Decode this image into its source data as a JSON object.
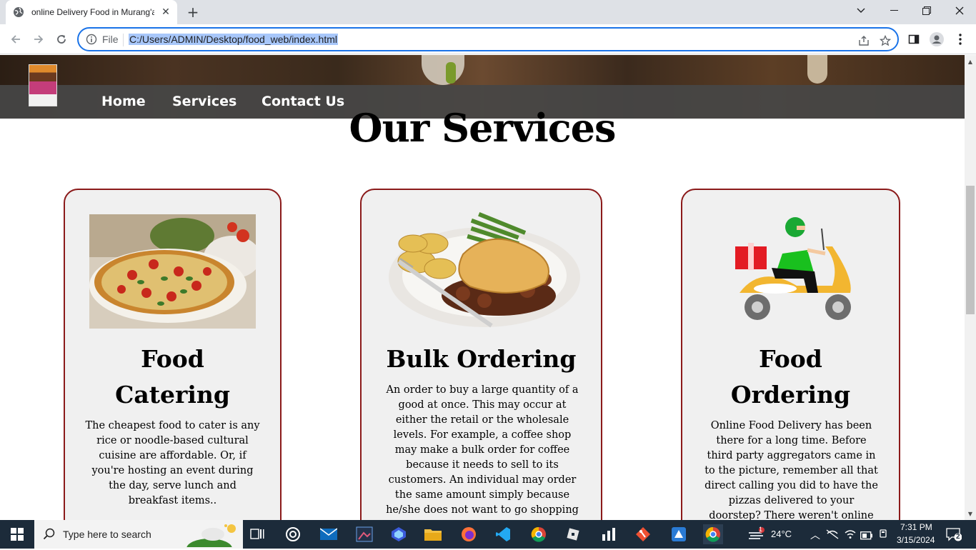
{
  "browser": {
    "tab_title": "online Delivery Food in Murang'a",
    "url_scheme_label": "File",
    "url": "C:/Users/ADMIN/Desktop/food_web/index.html"
  },
  "site": {
    "nav": [
      "Home",
      "Services",
      "Contact Us"
    ],
    "heading": "Our Services",
    "cards": [
      {
        "title_line1": "Food",
        "title_line2": "Catering",
        "text": "The cheapest food to cater is any rice or noodle-based cultural cuisine are affordable. Or, if you're hosting an event during the day, serve lunch and breakfast items..",
        "image_icon": "pizza-image"
      },
      {
        "title_line1": "Bulk Ordering",
        "title_line2": "",
        "text": "An order to buy a large quantity of a good at once. This may occur at either the retail or the wholesale levels. For example, a coffee shop may make a bulk order for coffee because it needs to sell to its customers. An individual may order the same amount simply because he/she does not want to go shopping",
        "image_icon": "pie-plate-image"
      },
      {
        "title_line1": "Food",
        "title_line2": "Ordering",
        "text": "Online Food Delivery has been there for a long time. Before third party aggregators came in to the picture, remember all that direct calling you did to have the pizzas delivered to your doorstep? There weren't online",
        "image_icon": "delivery-scooter-image"
      }
    ],
    "card_border_color": "#8b1a1a"
  },
  "taskbar": {
    "search_placeholder": "Type here to search",
    "weather": "24°C",
    "time": "7:31 PM",
    "date": "3/15/2024",
    "notification_count": "2",
    "weather_badge": "1"
  }
}
